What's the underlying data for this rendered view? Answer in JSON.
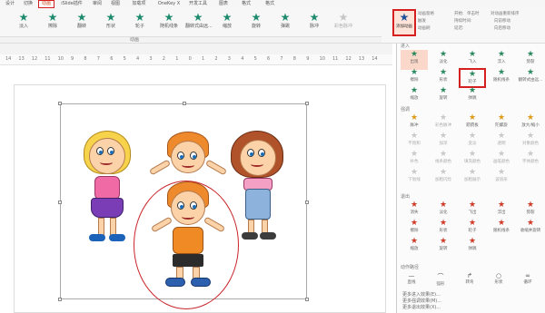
{
  "menu": {
    "tabs": [
      "设计",
      "切换",
      "动画",
      "iSlide插件",
      "审阅",
      "视图",
      "加载项",
      "OneKey X",
      "开发工具",
      "图表",
      "格式",
      "格式"
    ],
    "active_index": 2
  },
  "gallery": {
    "items": [
      {
        "label": "淡入",
        "muted": false
      },
      {
        "label": "擦除",
        "muted": false
      },
      {
        "label": "翻转",
        "muted": false
      },
      {
        "label": "形状",
        "muted": false
      },
      {
        "label": "轮子",
        "muted": false
      },
      {
        "label": "随机线条",
        "muted": false
      },
      {
        "label": "翻转式由远...",
        "muted": false
      },
      {
        "label": "缩放",
        "muted": false
      },
      {
        "label": "旋转",
        "muted": false
      },
      {
        "label": "弹跳",
        "muted": false
      },
      {
        "label": "脉冲",
        "muted": false
      },
      {
        "label": "彩色脉冲",
        "muted": true
      }
    ],
    "group_label": "动画"
  },
  "ribbon_right": {
    "add_animation": "添加动画",
    "anim_pane": "动画窗格",
    "trigger": "触发",
    "anim_painter": "动画刷",
    "start_label": "开始:",
    "start_value": "单击时",
    "duration_label": "持续时间:",
    "delay_label": "延迟:",
    "reorder_title": "对动画重新排序",
    "move_earlier": "向前移动",
    "move_later": "向后移动"
  },
  "ruler": {
    "numbers": [
      "14",
      "13",
      "12",
      "11",
      "10",
      "9",
      "8",
      "7",
      "6",
      "5",
      "4",
      "3",
      "2",
      "1",
      "0",
      "1",
      "2",
      "3",
      "4",
      "5",
      "6",
      "7",
      "8",
      "9",
      "10",
      "11",
      "12",
      "13",
      "14"
    ]
  },
  "pane": {
    "sections": {
      "entrance": "进入",
      "emphasis": "强调",
      "exit": "退出",
      "path": "动作路径"
    },
    "entrance": [
      {
        "label": "出现",
        "first": true
      },
      {
        "label": "淡化"
      },
      {
        "label": "飞入"
      },
      {
        "label": "浮入"
      },
      {
        "label": "劈裂"
      },
      {
        "label": "擦除"
      },
      {
        "label": "形状"
      },
      {
        "label": "轮子",
        "hl": true
      },
      {
        "label": "随机线条"
      },
      {
        "label": "翻转式由远..."
      },
      {
        "label": "缩放"
      },
      {
        "label": "旋转"
      },
      {
        "label": "弹跳"
      }
    ],
    "emphasis": [
      {
        "label": "脉冲"
      },
      {
        "label": "彩色脉冲",
        "muted": true
      },
      {
        "label": "跷跷板"
      },
      {
        "label": "陀螺旋"
      },
      {
        "label": "放大/缩小"
      },
      {
        "label": "不饱和",
        "muted": true
      },
      {
        "label": "加深",
        "muted": true
      },
      {
        "label": "变淡",
        "muted": true
      },
      {
        "label": "透明",
        "muted": true
      },
      {
        "label": "对象颜色",
        "muted": true
      },
      {
        "label": "补色",
        "muted": true
      },
      {
        "label": "线条颜色",
        "muted": true
      },
      {
        "label": "填充颜色",
        "muted": true
      },
      {
        "label": "画笔颜色",
        "muted": true
      },
      {
        "label": "字体颜色",
        "muted": true
      },
      {
        "label": "下划线",
        "muted": true
      },
      {
        "label": "加粗闪烁",
        "muted": true
      },
      {
        "label": "加粗展示",
        "muted": true
      },
      {
        "label": "波浪形",
        "muted": true
      }
    ],
    "exit": [
      {
        "label": "消失"
      },
      {
        "label": "淡化"
      },
      {
        "label": "飞出"
      },
      {
        "label": "浮出"
      },
      {
        "label": "劈裂"
      },
      {
        "label": "擦除"
      },
      {
        "label": "形状"
      },
      {
        "label": "轮子"
      },
      {
        "label": "随机线条"
      },
      {
        "label": "收缩并旋转"
      },
      {
        "label": "缩放"
      },
      {
        "label": "旋转"
      },
      {
        "label": "弹跳"
      }
    ],
    "paths": [
      {
        "label": "直线"
      },
      {
        "label": "弧形"
      },
      {
        "label": "转弯"
      },
      {
        "label": "形状"
      },
      {
        "label": "循环"
      }
    ],
    "more": [
      "更多进入效果(E)...",
      "更多强调效果(M)...",
      "更多退出效果(X)..."
    ]
  },
  "colors": {
    "accent": "#d04a1d",
    "highlight_box": "#d62020",
    "entrance_star": "#2a8a5e",
    "emphasis_star": "#e09b1a",
    "exit_star": "#cf3b29"
  }
}
